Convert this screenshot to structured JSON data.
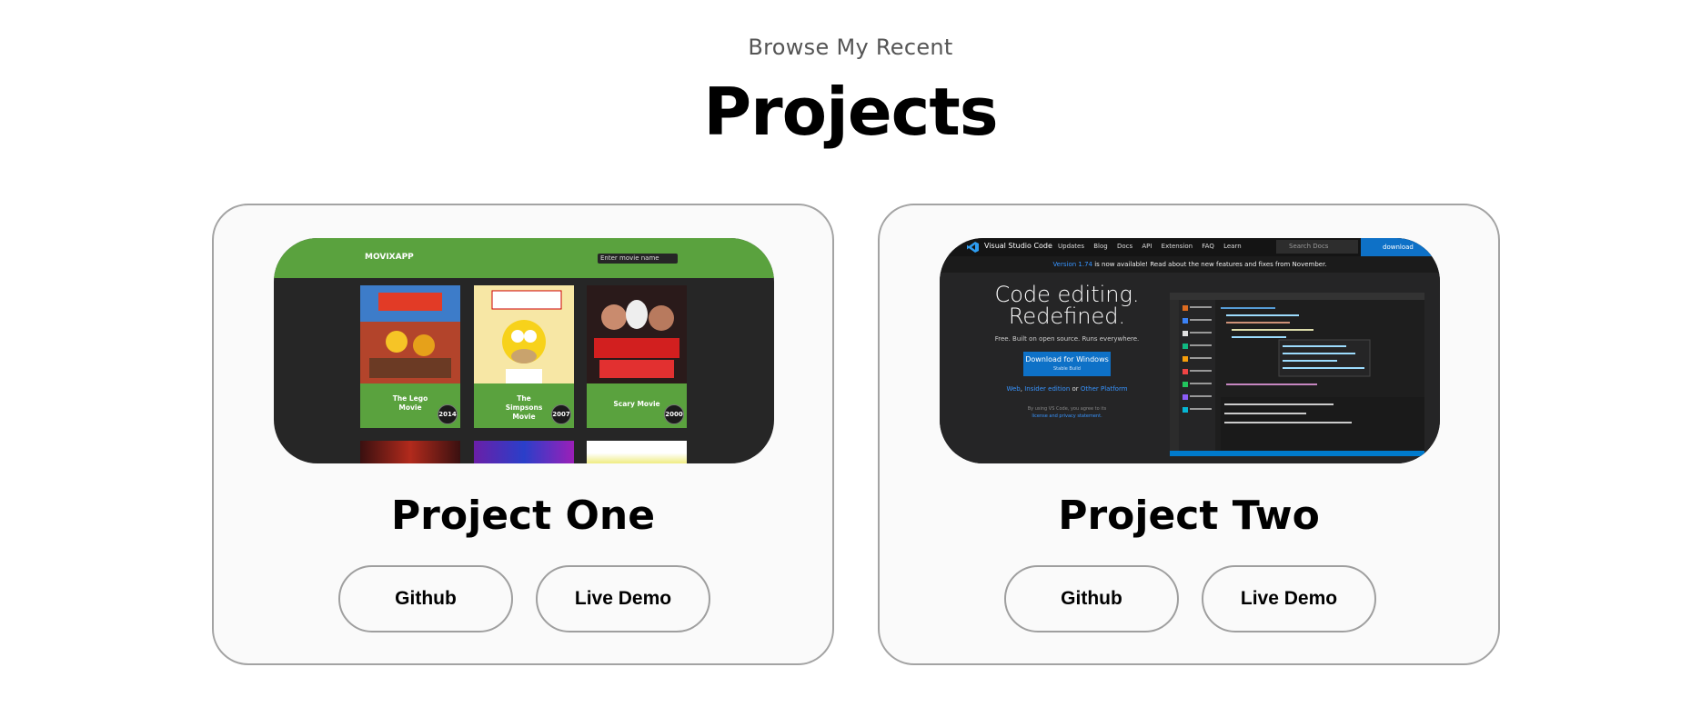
{
  "header": {
    "subtitle": "Browse My Recent",
    "title": "Projects"
  },
  "projects": [
    {
      "title": "Project One",
      "github_label": "Github",
      "demo_label": "Live Demo",
      "preview": {
        "logo": "MOVIXAPP",
        "search_placeholder": "Enter movie name",
        "movies": [
          {
            "name_line1": "The Lego",
            "name_line2": "Movie",
            "name_line3": "",
            "year": "2014"
          },
          {
            "name_line1": "The",
            "name_line2": "Simpsons",
            "name_line3": "Movie",
            "year": "2007"
          },
          {
            "name_line1": "Scary Movie",
            "name_line2": "",
            "name_line3": "",
            "year": "2000"
          }
        ]
      }
    },
    {
      "title": "Project Two",
      "github_label": "Github",
      "demo_label": "Live Demo",
      "preview": {
        "brand": "Visual Studio Code",
        "nav": [
          "Updates",
          "Blog",
          "Docs",
          "API",
          "Extension",
          "FAQ",
          "Learn"
        ],
        "search_placeholder": "Search Docs",
        "download_label": "download",
        "banner_version": "Version 1.74",
        "banner_text": " is now available! Read about the new features and fixes from November.",
        "headline_line1": "Code editing.",
        "headline_line2": "Redefined.",
        "tagline": "Free. Built on open source. Runs everywhere.",
        "download_button": "Download for Windows",
        "download_sub": "Stable Build",
        "alt_link1": "Web",
        "alt_link2": "Insider edition",
        "alt_or": " or ",
        "alt_link3": "Other Platform",
        "fine_print": "By using VS Code, you agree to its",
        "fine_print_link": "license and privacy statement."
      }
    }
  ],
  "colors": {
    "movix_green": "#5aa23e",
    "vscode_blue": "#0e71c7"
  }
}
